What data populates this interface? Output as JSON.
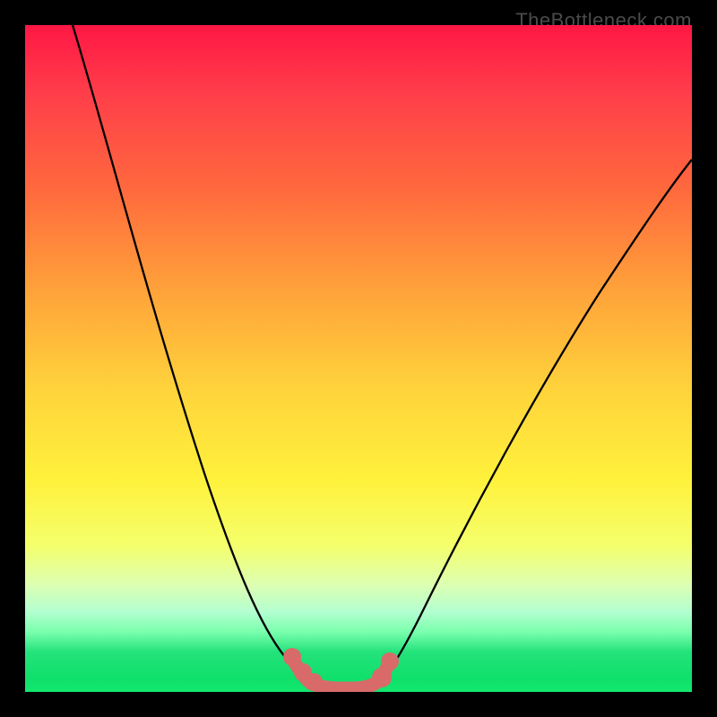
{
  "watermark": "TheBottleneck.com",
  "chart_data": {
    "type": "line",
    "title": "",
    "xlabel": "",
    "ylabel": "",
    "x": [
      0.0,
      0.05,
      0.1,
      0.15,
      0.2,
      0.25,
      0.3,
      0.35,
      0.4,
      0.42,
      0.44,
      0.48,
      0.5,
      0.55,
      0.6,
      0.65,
      0.7,
      0.75,
      0.8,
      0.85,
      0.9,
      0.95,
      1.0
    ],
    "values": [
      1.0,
      0.93,
      0.79,
      0.65,
      0.5,
      0.36,
      0.23,
      0.12,
      0.04,
      0.01,
      0.0,
      0.0,
      0.01,
      0.08,
      0.18,
      0.28,
      0.37,
      0.45,
      0.52,
      0.58,
      0.63,
      0.67,
      0.7
    ],
    "trough_x_range": [
      0.4,
      0.5
    ],
    "xlim": [
      0,
      1
    ],
    "ylim": [
      0,
      1
    ],
    "gradient_stops": [
      {
        "pos": 0.0,
        "color": "#ff1744"
      },
      {
        "pos": 0.55,
        "color": "#ffd43b"
      },
      {
        "pos": 0.94,
        "color": "#24e27b"
      },
      {
        "pos": 1.0,
        "color": "#12e86e"
      }
    ]
  }
}
